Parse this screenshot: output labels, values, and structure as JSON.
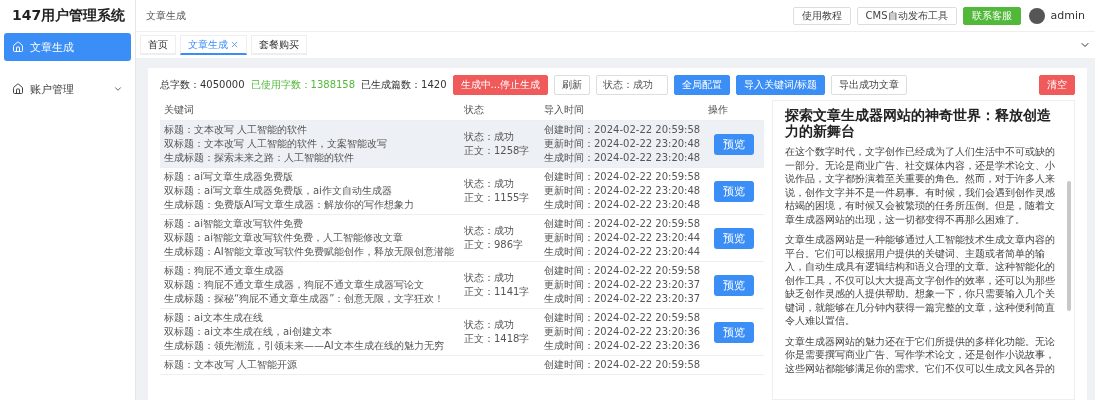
{
  "sidebar": {
    "title": "147用户管理系统",
    "items": [
      {
        "label": "文章生成",
        "selected": true,
        "has_submenu": false
      },
      {
        "label": "账户管理",
        "selected": false,
        "has_submenu": true,
        "expanded": false
      }
    ]
  },
  "header": {
    "breadcrumb": "文章生成",
    "buttons": [
      {
        "label": "使用教程",
        "kind": "default"
      },
      {
        "label": "CMS自动发布工具",
        "kind": "default"
      },
      {
        "label": "联系客服",
        "kind": "success"
      }
    ],
    "user": "admin"
  },
  "tabs": [
    {
      "label": "首页",
      "selected": false,
      "closable": false
    },
    {
      "label": "文章生成",
      "selected": true,
      "closable": true
    },
    {
      "label": "套餐购买",
      "selected": false,
      "closable": false
    }
  ],
  "stats": [
    {
      "label": "总字数：4050000",
      "kind": "normal"
    },
    {
      "label": "已使用字数：1388158",
      "kind": "used"
    },
    {
      "label": "已生成篇数：1420",
      "kind": "normal"
    }
  ],
  "toolbar": [
    {
      "label": "生成中...停止生成",
      "kind": "danger"
    },
    {
      "label": "刷新",
      "kind": "default"
    },
    {
      "label": "状态：成功",
      "kind": "select"
    },
    {
      "label": "全局配置",
      "kind": "primary"
    },
    {
      "label": "导入关键词/标题",
      "kind": "primary"
    },
    {
      "label": "导出成功文章",
      "kind": "default"
    }
  ],
  "clear_button": "清空",
  "table": {
    "columns": [
      "关键词",
      "状态",
      "导入时间",
      "操作"
    ],
    "rows": [
      {
        "hovered": true,
        "keyword": [
          "标题：文本改写 人工智能的软件",
          "双标题：文本改写 人工智能的软件，文案智能改写",
          "生成标题：探索未来之路：人工智能的软件"
        ],
        "status": [
          "状态：成功",
          "正文：1258字"
        ],
        "times": [
          "创建时间：2024-02-22 20:59:58",
          "更新时间：2024-02-22 23:20:48",
          "生成时间：2024-02-22 23:20:48"
        ],
        "action": "预览"
      },
      {
        "hovered": false,
        "keyword": [
          "标题：ai写文章生成器免费版",
          "双标题：ai写文章生成器免费版，ai作文自动生成器",
          "生成标题：免费版AI写文章生成器：解放你的写作想象力"
        ],
        "status": [
          "状态：成功",
          "正文：1155字"
        ],
        "times": [
          "创建时间：2024-02-22 20:59:58",
          "更新时间：2024-02-22 23:20:48",
          "生成时间：2024-02-22 23:20:48"
        ],
        "action": "预览"
      },
      {
        "hovered": false,
        "keyword": [
          "标题：ai智能文章改写软件免费",
          "双标题：ai智能文章改写软件免费，人工智能修改文章",
          "生成标题：AI智能文章改写软件免费赋能创作，释放无限创意潜能"
        ],
        "status": [
          "状态：成功",
          "正文：986字"
        ],
        "times": [
          "创建时间：2024-02-22 20:59:58",
          "更新时间：2024-02-22 23:20:44",
          "生成时间：2024-02-22 23:20:44"
        ],
        "action": "预览"
      },
      {
        "hovered": false,
        "keyword": [
          "标题：狗屁不通文章生成器",
          "双标题：狗屁不通文章生成器，狗屁不通文章生成器写论文",
          "生成标题：探秘“狗屁不通文章生成器”：创意无限，文字狂欢！"
        ],
        "status": [
          "状态：成功",
          "正文：1141字"
        ],
        "times": [
          "创建时间：2024-02-22 20:59:58",
          "更新时间：2024-02-22 23:20:37",
          "生成时间：2024-02-22 23:20:37"
        ],
        "action": "预览"
      },
      {
        "hovered": false,
        "keyword": [
          "标题：ai文本生成在线",
          "双标题：ai文本生成在线，ai创建文本",
          "生成标题：领先潮流，引领未来——AI文本生成在线的魅力无穷"
        ],
        "status": [
          "状态：成功",
          "正文：1418字"
        ],
        "times": [
          "创建时间：2024-02-22 20:59:58",
          "更新时间：2024-02-22 23:20:36",
          "生成时间：2024-02-22 23:20:36"
        ],
        "action": "预览"
      },
      {
        "hovered": false,
        "keyword": [
          "标题：文本改写 人工智能开源"
        ],
        "status": [],
        "times": [
          "创建时间：2024-02-22 20:59:58"
        ]
      }
    ]
  },
  "preview": {
    "title": "探索文章生成器网站的神奇世界：释放创造力的新舞台",
    "paragraphs": [
      "在这个数字时代，文字创作已经成为了人们生活中不可或缺的一部分。无论是商业广告、社交媒体内容，还是学术论文、小说作品，文字都扮演着至关重要的角色。然而，对于许多人来说，创作文字并不是一件易事。有时候，我们会遇到创作灵感枯竭的困境，有时候又会被繁琐的任务所压倒。但是，随着文章生成器网站的出现，这一切都变得不再那么困难了。",
      "文章生成器网站是一种能够通过人工智能技术生成文章内容的平台。它们可以根据用户提供的关键词、主题或者简单的输入，自动生成具有逻辑结构和语义合理的文章。这种智能化的创作工具，不仅可以大大提高文字创作的效率，还可以为那些缺乏创作灵感的人提供帮助。想象一下，你只需要输入几个关键词，就能够在几分钟内获得一篇完整的文章，这种便利简直令人难以置信。",
      "文章生成器网站的魅力还在于它们所提供的多样化功能。无论你是需要撰写商业广告、写作学术论文，还是创作小说故事，这些网站都能够满足你的需求。它们不仅可以生成文风各异的"
    ]
  }
}
